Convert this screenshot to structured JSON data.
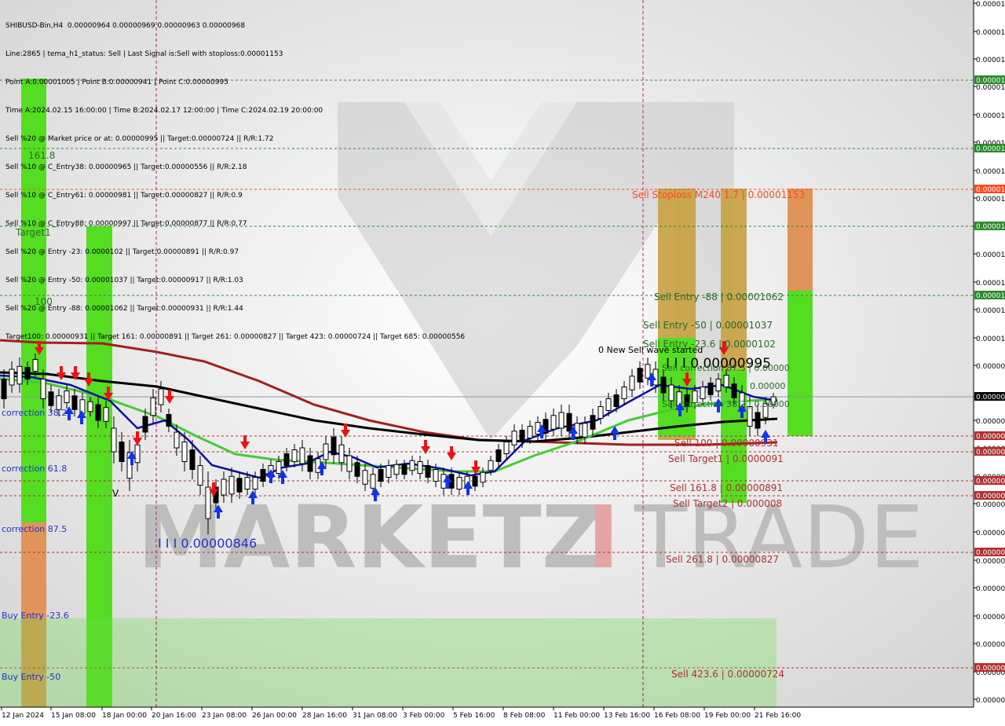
{
  "header": {
    "symbol_line": "SHIBUSD-Bin,H4  0.00000964 0.00000969 0.00000963 0.00000968",
    "lines": [
      "Line:2865 | tema_h1_status: Sell | Last Signal is:Sell with stoploss:0.00001153",
      "Point A:0.00001005 | Point B:0.00000941 | Point C:0.00000995",
      "Time A:2024.02.15 16:00:00 | Time B:2024.02.17 12:00:00 | Time C:2024.02.19 20:00:00",
      "Sell %20 @ Market price or at: 0.00000995 || Target:0.00000724 || R/R:1.72",
      "Sell %10 @ C_Entry38: 0.00000965 || Target:0.00000556 || R/R:2.18",
      "Sell %10 @ C_Entry61: 0.00000981 || Target:0.00000827 || R/R:0.9",
      "Sell %10 @ C_Entry88: 0.00000997 || Target:0.00000877 || R/R:0.77",
      "Sell %20 @ Entry -23: 0.0000102 || Target:0.00000891 || R/R:0.97",
      "Sell %20 @ Entry -50: 0.00001037 || Target:0.00000917 || R/R:1.03",
      "Sell %20 @ Entry -88: 0.00001062 || Target:0.00000931 || R/R:1.44",
      "Target100: 0.00000931 || Target 161: 0.00000891 || Target 261: 0.00000827 || Target 423: 0.00000724 || Target 685: 0.00000556"
    ]
  },
  "watermark": {
    "brand_left": "MARKETZ",
    "brand_i": "I",
    "brand_right": "TRADE"
  },
  "levels": [
    {
      "id": "lvl-1",
      "label": "",
      "value": 1.21e-05,
      "color": "#2a8a2a",
      "axis": "0.00001"
    },
    {
      "id": "lvl-2",
      "label": "",
      "value": 1.185e-05,
      "color": "#2a8a2a",
      "axis": "0.00001"
    },
    {
      "id": "lvl-stoploss",
      "label": "Sell Stoploss M240 1.7 | 0.00001153",
      "value": 1.153e-05,
      "color": "#ff4a1a",
      "axis": "0.00001"
    },
    {
      "id": "lvl-3",
      "label": "",
      "value": 1.128e-05,
      "color": "#2a8a2a",
      "axis": "0.00001"
    },
    {
      "id": "lvl-entry88",
      "label": "Sell Entry -88 | 0.00001062",
      "value": 1.062e-05,
      "color": "#2a8a2a",
      "axis": "0.00001"
    },
    {
      "id": "lvl-current",
      "label": "",
      "value": 9.68e-06,
      "color": "#8899aa",
      "axis": "0.00000"
    },
    {
      "id": "lvl-sell100",
      "label": "Sell 100 | 0.00000931",
      "value": 9.38e-06,
      "color": "#b03030",
      "axis": "0.00000"
    },
    {
      "id": "lvl-target1",
      "label": "Sell Target1 | 0.0000091",
      "value": 9.31e-06,
      "color": "#b03030",
      "axis": "0.00000"
    },
    {
      "id": "lvl-161",
      "label": "Sell 161.8 | 0.00000891",
      "value": 9.15e-06,
      "color": "#b03030",
      "axis": "0.00000"
    },
    {
      "id": "lvl-target2",
      "label": "Sell Target2 | 0.000008",
      "value": 9.1e-06,
      "color": "#b03030",
      "axis": "0.00000"
    },
    {
      "id": "lvl-261",
      "label": "Sell  261.8 | 0.00000827",
      "value": 8.9e-06,
      "color": "#b03030",
      "axis": "0.00000"
    },
    {
      "id": "lvl-423",
      "label": "Sell  423.6 | 0.00000724",
      "value": 8.48e-06,
      "color": "#b03030",
      "axis": "0.00000"
    }
  ],
  "plain_labels": [
    {
      "id": "lbl-entry50",
      "text": "Sell Entry -50 | 0.00001037",
      "color": "#2a6a2a"
    },
    {
      "id": "lbl-entry236",
      "text": "Sell Entry -23.6 | 0.0000102",
      "color": "#2a6a2a"
    },
    {
      "id": "lbl-new-wave",
      "text": "0 New Sell wave started",
      "color": "#000000"
    },
    {
      "id": "lbl-point-c",
      "text": "I I I 0.00000995",
      "color": "#000000"
    },
    {
      "id": "lbl-sell-correction",
      "text": "Sell correction 87.5 | 0.00000",
      "color": "#2a6a2a"
    },
    {
      "id": "lbl-sell-correction-mid",
      "text": "0.00000",
      "color": "#2a6a2a"
    },
    {
      "id": "lbl-sell-correction-low",
      "text": "Sell correction 38.2 | 0.00000",
      "color": "#2a6a2a"
    },
    {
      "id": "lbl-low-point",
      "text": "I I I 0.00000846",
      "color": "#2233cc"
    },
    {
      "id": "lbl-161-left",
      "text": "161.8",
      "color": "#2a6a2a"
    },
    {
      "id": "lbl-target1-left",
      "text": "Target1",
      "color": "#2a6a2a"
    },
    {
      "id": "lbl-100-left",
      "text": "100",
      "color": "#2a6a2a"
    },
    {
      "id": "lbl-correction382",
      "text": "correction 38.2",
      "color": "#2233cc"
    },
    {
      "id": "lbl-correction618",
      "text": "correction 61.8",
      "color": "#2233cc"
    },
    {
      "id": "lbl-correction875",
      "text": "correction 87.5",
      "color": "#2233cc"
    },
    {
      "id": "lbl-buy-entry236",
      "text": "Buy Entry -23.6",
      "color": "#2233cc"
    },
    {
      "id": "lbl-buy-entry50",
      "text": "Buy Entry -50",
      "color": "#2233cc"
    },
    {
      "id": "lbl-v",
      "text": "V",
      "color": "#000000"
    }
  ],
  "axis": {
    "price_labels": [
      "0.00001",
      "0.00001",
      "0.00001",
      "0.00001",
      "0.00001",
      "0.00001",
      "0.00001",
      "0.00001",
      "0.00001",
      "0.00001",
      "0.00001",
      "0.00001",
      "0.00001",
      "0.00000",
      "0.00000",
      "0.00000",
      "0.00000",
      "0.00000",
      "0.00000",
      "0.00000",
      "0.00000",
      "0.00000",
      "0.00000",
      "0.00000",
      "0.00000",
      "0.00000"
    ],
    "date_labels": [
      "12 Jan 2024",
      "15 Jan 08:00",
      "18 Jan 00:00",
      "20 Jan 16:00",
      "23 Jan 08:00",
      "26 Jan 00:00",
      "28 Jan 16:00",
      "31 Jan 08:00",
      "3 Feb 00:00",
      "5 Feb 16:00",
      "8 Feb 08:00",
      "11 Feb 00:00",
      "13 Feb 16:00",
      "16 Feb 08:00",
      "19 Feb 00:00",
      "21 Feb 16:00"
    ]
  },
  "colors": {
    "green_bar": "#55dd22",
    "orange_bar": "#e0945a",
    "olive_bar": "#c8a040",
    "sell_level": "#b03030",
    "green_level": "#2a8a2a",
    "stoploss": "#ff4a1a",
    "ema_fast": "#1010a0",
    "ema_mid": "#44cc33",
    "ema_slow": "#000000",
    "ema_long": "#a02020",
    "arrow_up": "#1133ee",
    "arrow_down": "#ee1111"
  },
  "chart_data": {
    "type": "line",
    "title": "SHIBUSD-Bin,H4",
    "ylim": [
      7.2e-06,
      1.24e-05
    ],
    "x": [
      "12 Jan 2024",
      "15 Jan 08:00",
      "18 Jan 00:00",
      "20 Jan 16:00",
      "23 Jan 08:00",
      "26 Jan 00:00",
      "28 Jan 16:00",
      "31 Jan 08:00",
      "3 Feb 00:00",
      "5 Feb 16:00",
      "8 Feb 08:00",
      "11 Feb 00:00",
      "13 Feb 16:00",
      "16 Feb 08:00",
      "19 Feb 00:00",
      "21 Feb 16:00"
    ],
    "series": [
      {
        "name": "",
        "values": [
          9.68e-06,
          9.55e-06,
          9.35e-06,
          9.3e-06,
          8.85e-06,
          9.05e-06,
          9.2e-06,
          9e-06,
          9.1e-06,
          8.95e-06,
          9.4e-06,
          9.55e-06,
          9.85e-06,
          9.75e-06,
          9.8e-06,
          9.68e-06
        ]
      }
    ]
  }
}
